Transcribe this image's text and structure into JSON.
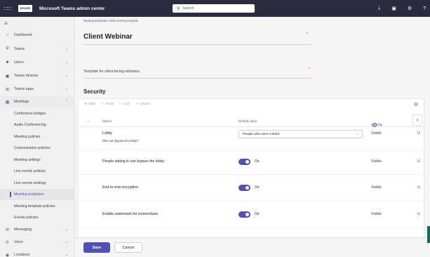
{
  "topbar": {
    "logo_text": "DEXXER",
    "app_title": "Microsoft Teams admin center",
    "search_placeholder": "Search"
  },
  "sidebar": {
    "items": [
      {
        "label": "Dashboard",
        "icon": "home-icon"
      },
      {
        "label": "Teams",
        "icon": "teams-icon",
        "chevron": true
      },
      {
        "label": "Users",
        "icon": "users-icon",
        "chevron": true
      },
      {
        "label": "Teams devices",
        "icon": "devices-icon",
        "chevron": true
      },
      {
        "label": "Teams apps",
        "icon": "apps-icon",
        "chevron": true
      },
      {
        "label": "Meetings",
        "icon": "calendar-icon",
        "chevron": true,
        "expanded": true
      }
    ],
    "meeting_subitems": [
      "Conference bridges",
      "Audio Conferencing",
      "Meeting policies",
      "Customization policies",
      "Meeting settings",
      "Live events policies",
      "Live events settings",
      "Meeting templates",
      "Meeting template policies",
      "Events policies"
    ],
    "active_subitem": "Meeting templates",
    "bottom_items": [
      {
        "label": "Messaging",
        "icon": "chat-icon"
      },
      {
        "label": "Voice",
        "icon": "phone-icon"
      },
      {
        "label": "Locations",
        "icon": "globe-icon"
      }
    ]
  },
  "breadcrumb": {
    "parent": "Meeting templates",
    "separator": "\\",
    "current": "Edit meeting template"
  },
  "template": {
    "name": "Client Webinar",
    "description": "Template for client-facing webinars."
  },
  "security": {
    "title": "Security",
    "toolbar": [
      "Hide",
      "Show",
      "Lock",
      "Unlock"
    ],
    "columns": {
      "option": "Option",
      "default_value": "Default value",
      "visibility": "Visibility"
    },
    "rows": [
      {
        "option": "Lobby",
        "sub": "Who can bypass the lobby?",
        "value": "People who were invited",
        "visibility": "Visible",
        "trunc": "U"
      },
      {
        "option": "People dialing in can bypass the lobby",
        "value": "On",
        "visibility": "Visible",
        "trunc": "U"
      },
      {
        "option": "End-to-end encryption",
        "value": "On",
        "visibility": "Visible",
        "trunc": "U"
      },
      {
        "option": "Enable watermark for screenshare",
        "value": "On",
        "visibility": "Visible",
        "trunc": "U"
      }
    ]
  },
  "footer": {
    "save": "Save",
    "cancel": "Cancel"
  },
  "colors": {
    "accent": "#4f52b2",
    "topbar": "#2b2b40"
  }
}
